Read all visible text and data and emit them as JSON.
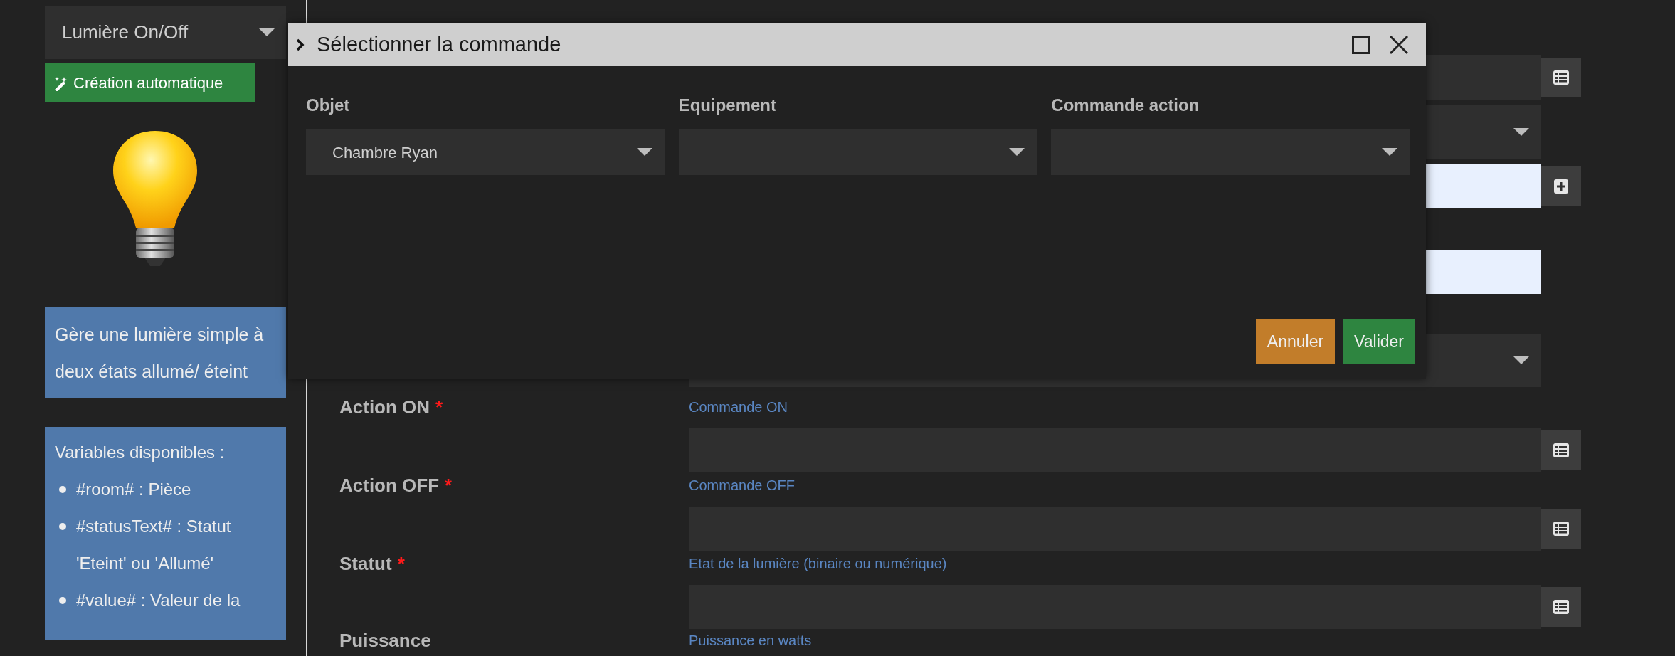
{
  "sidebar": {
    "template_select": {
      "value": "Lumière On/Off"
    },
    "auto_button": {
      "label": "Création automatique"
    },
    "description": "Gère une lumière simple à deux états allumé/ éteint",
    "variables": {
      "title": "Variables disponibles :",
      "items": [
        "#room# : Pièce",
        "#statusText# : Statut 'Eteint' ou 'Allumé'",
        "#value# : Valeur de la"
      ]
    }
  },
  "form": {
    "rows": [
      {
        "kind": "input-list"
      },
      {
        "kind": "select"
      },
      {
        "kind": "light-input-plus"
      },
      {
        "kind": "light-input"
      },
      {
        "kind": "select"
      },
      {
        "kind": "input-list",
        "label": "Action ON",
        "required_mark": "*",
        "help": "Commande ON"
      },
      {
        "kind": "input-list",
        "label": "Action OFF",
        "required_mark": "*",
        "help": "Commande OFF"
      },
      {
        "kind": "input-list",
        "label": "Statut",
        "required_mark": "*",
        "help": "Etat de la lumière (binaire ou numérique)"
      },
      {
        "kind": "label",
        "label": "Puissance",
        "help": "Puissance en watts"
      }
    ]
  },
  "dialog": {
    "title": "Sélectionner la commande",
    "fields": [
      {
        "label": "Objet",
        "value": "Chambre Ryan"
      },
      {
        "label": "Equipement"
      },
      {
        "label": "Commande action"
      }
    ],
    "buttons": [
      {
        "label": "Annuler",
        "kind": "cancel"
      },
      {
        "label": "Valider",
        "kind": "confirm"
      }
    ]
  }
}
